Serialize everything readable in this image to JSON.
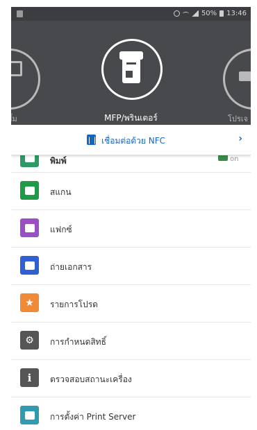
{
  "status_bar": {
    "battery_percent": "50%",
    "time": "13:46"
  },
  "devices": {
    "left_label": "ขั้ม",
    "main_label": "MFP/พรินเตอร์",
    "right_label": "โปรเจ"
  },
  "nfc": {
    "label": "เชื่อมต่อด้วย NFC",
    "chevron": "›"
  },
  "list": {
    "items": [
      {
        "label": "พิมพ์",
        "icon": "print-icon",
        "color": "#2e9a66",
        "badge": "on"
      },
      {
        "label": "สแกน",
        "icon": "scan-icon",
        "color": "#1f9a48"
      },
      {
        "label": "แฟกซ์",
        "icon": "fax-icon",
        "color": "#9a4fc2"
      },
      {
        "label": "ถ่ายเอกสาร",
        "icon": "copy-icon",
        "color": "#2f5fd2"
      },
      {
        "label": "รายการโปรด",
        "icon": "star-icon",
        "color": "#f08a36"
      },
      {
        "label": "การกำหนดสิทธิ์",
        "icon": "gear-icon",
        "color": "#555555"
      },
      {
        "label": "ตรวจสอบสถานะเครื่อง",
        "icon": "info-icon",
        "color": "#555555"
      },
      {
        "label": "การตั้งค่า Print Server",
        "icon": "print-server-icon",
        "color": "#2f9ab0"
      }
    ]
  },
  "colors": {
    "accent": "#1565c0",
    "carousel_bg": "#47494c",
    "status_bg": "#3c3d40"
  }
}
